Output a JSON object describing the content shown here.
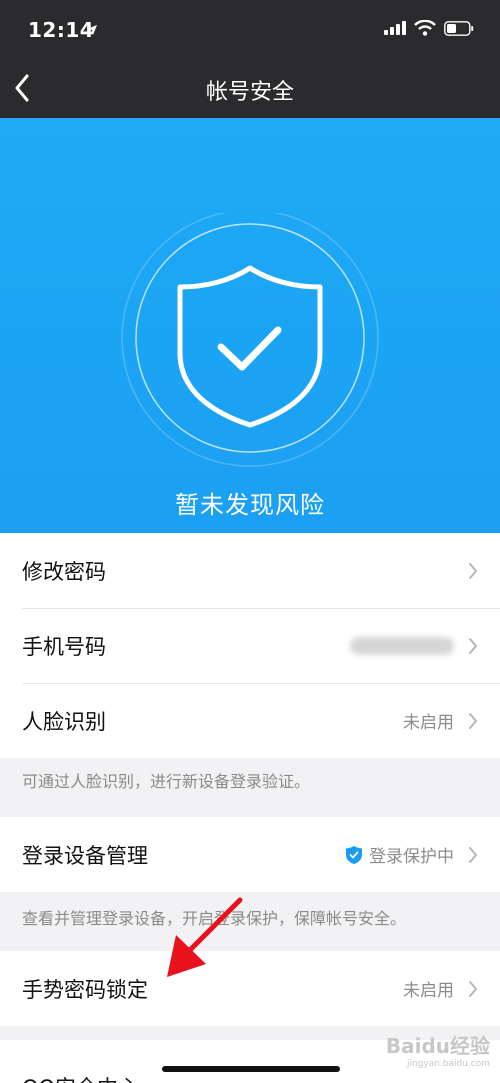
{
  "status_bar": {
    "time": "12:14"
  },
  "nav": {
    "title": "帐号安全"
  },
  "hero": {
    "status_text": "暂未发现风险"
  },
  "group1": {
    "items": [
      {
        "label": "修改密码",
        "value": ""
      },
      {
        "label": "手机号码",
        "value": ""
      },
      {
        "label": "人脸识别",
        "value": "未启用"
      }
    ]
  },
  "hint1": "可通过人脸识别，进行新设备登录验证。",
  "group2": {
    "items": [
      {
        "label": "登录设备管理",
        "value": "登录保护中"
      }
    ]
  },
  "hint2": "查看并管理登录设备，开启登录保护，保障帐号安全。",
  "group3": {
    "items": [
      {
        "label": "手势密码锁定",
        "value": "未启用"
      }
    ]
  },
  "partial_row_label": "QQ安全中心",
  "watermark": {
    "brand": "Baidu经验",
    "url": "jingyan.baidu.com"
  },
  "colors": {
    "hero_blue": "#1eaaf6",
    "dark_bar": "#2b2b2e",
    "arrow_red": "#e8121d"
  }
}
